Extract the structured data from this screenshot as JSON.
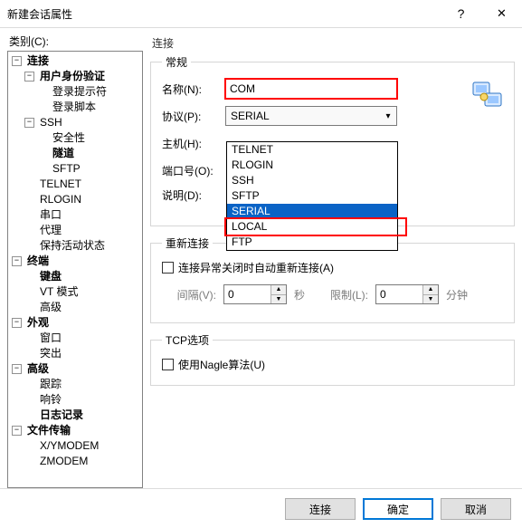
{
  "window": {
    "title": "新建会话属性",
    "help": "?",
    "close": "✕"
  },
  "category_label": "类别(C):",
  "tree": {
    "connection": "连接",
    "user_auth": "用户身份验证",
    "login_prompt": "登录提示符",
    "login_script": "登录脚本",
    "ssh": "SSH",
    "security": "安全性",
    "tunnel": "隧道",
    "sftp": "SFTP",
    "telnet": "TELNET",
    "rlogin": "RLOGIN",
    "serial": "串口",
    "proxy": "代理",
    "keepalive": "保持活动状态",
    "terminal": "终端",
    "keyboard": "键盘",
    "vt_mode": "VT 模式",
    "advanced_term": "高级",
    "appearance": "外观",
    "window": "窗口",
    "highlight": "突出",
    "advanced": "高级",
    "trace": "跟踪",
    "bell": "响铃",
    "logging": "日志记录",
    "file_transfer": "文件传输",
    "xymodem": "X/YMODEM",
    "zmodem": "ZMODEM"
  },
  "panel": {
    "heading": "连接",
    "group_general": "常规",
    "name_label": "名称(N):",
    "name_value": "COM",
    "protocol_label": "协议(P):",
    "protocol_value": "SERIAL",
    "host_label": "主机(H):",
    "port_label": "端口号(O):",
    "desc_label": "说明(D):",
    "dropdown": {
      "options": [
        "TELNET",
        "RLOGIN",
        "SSH",
        "SFTP",
        "SERIAL",
        "LOCAL",
        "FTP"
      ],
      "selected": "SERIAL"
    },
    "group_reconnect": "重新连接",
    "reconnect_checkbox": "连接异常关闭时自动重新连接(A)",
    "interval_label": "间隔(V):",
    "interval_value": "0",
    "interval_unit": "秒",
    "limit_label": "限制(L):",
    "limit_value": "0",
    "limit_unit": "分钟",
    "group_tcp": "TCP选项",
    "nagle_checkbox": "使用Nagle算法(U)"
  },
  "buttons": {
    "connect": "连接",
    "ok": "确定",
    "cancel": "取消"
  }
}
